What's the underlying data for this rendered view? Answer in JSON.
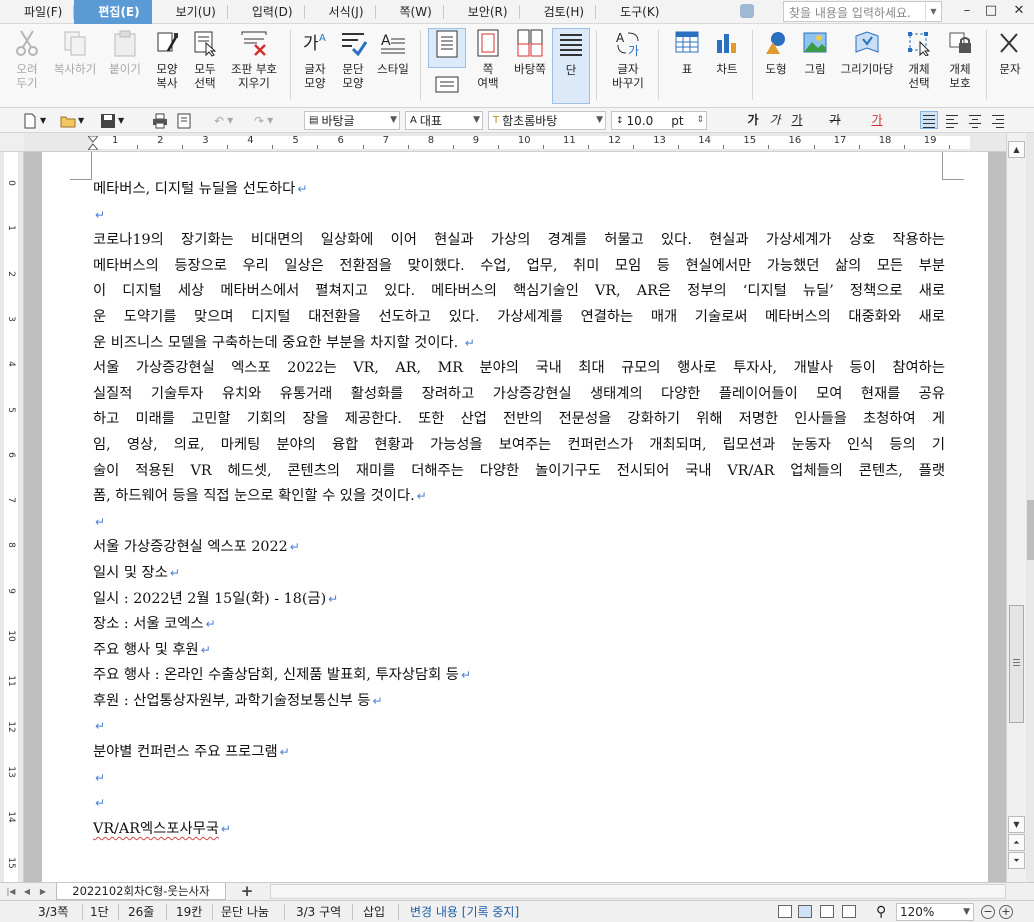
{
  "menu": {
    "items": [
      "파일(F)",
      "편집(E)",
      "보기(U)",
      "입력(D)",
      "서식(J)",
      "쪽(W)",
      "보안(R)",
      "검토(H)",
      "도구(K)"
    ],
    "active_index": 1,
    "search_placeholder": "찾을 내용을 입력하세요.",
    "minimize": "–",
    "restore": "□",
    "close": "✕"
  },
  "ribbon": {
    "cut": "오려\n두기",
    "copy": "복사하기",
    "paste": "붙이기",
    "format_copy": "모양\n복사",
    "select_all": "모두\n선택",
    "clear_format": "조판 부호\n지우기",
    "char_shape": "글자\n모양",
    "para_shape": "문단\n모양",
    "style": "스타일",
    "margin": "쪽\n여백",
    "page_size": "바탕쪽",
    "columns": "단",
    "char_replace": "글자\n바꾸기",
    "table": "표",
    "chart": "차트",
    "shape": "도형",
    "picture": "그림",
    "clipart": "그리기마당",
    "obj_select": "개체\n선택",
    "obj_protect": "개체\n보호",
    "text": "문자"
  },
  "toolbar": {
    "style_combo": "바탕글",
    "lang_combo": "대표",
    "font_combo": "함초롬바탕",
    "size_combo": "10.0",
    "size_unit": "pt",
    "bold": "가",
    "italic": "가",
    "underline": "가",
    "strike": "가",
    "color": "가"
  },
  "ruler": {
    "h_numbers": [
      "1",
      "2",
      "3",
      "4",
      "5",
      "6",
      "7",
      "8",
      "9",
      "10",
      "11",
      "12",
      "13",
      "14",
      "15",
      "16",
      "17",
      "18",
      "19"
    ],
    "v_numbers": [
      "0",
      "1",
      "2",
      "3",
      "4",
      "5",
      "6",
      "7",
      "8",
      "9",
      "10",
      "11",
      "12",
      "13",
      "14",
      "15"
    ]
  },
  "doc": {
    "title": "메타버스, 디지털 뉴딜을 선도하다",
    "p1_lines": [
      "코로나19의 장기화는 비대면의 일상화에 이어 현실과 가상의 경계를 허물고 있다. 현실과 가상세계가 상호 작용하는",
      "메타버스의 등장으로 우리 일상은 전환점을 맞이했다. 수업, 업무, 취미 모임 등 현실에서만 가능했던 삶의 모든 부분",
      "이 디지털 세상 메타버스에서 펼쳐지고 있다. 메타버스의 핵심기술인 VR, AR은 정부의 ‘디지털 뉴딜’ 정책으로 새로",
      "운 도약기를 맞으며 디지털 대전환을 선도하고 있다. 가상세계를 연결하는 매개 기술로써 메타버스의 대중화와 새로",
      "운 비즈니스 모델을 구축하는데 중요한 부분을 차지할 것이다. "
    ],
    "p2_lines": [
      "  서울 가상증강현실 엑스포 2022는 VR, AR, MR 분야의 국내 최대 규모의 행사로 투자사, 개발사 등이 참여하는",
      "실질적 기술투자 유치와 유통거래 활성화를 장려하고 가상증강현실 생태계의 다양한 플레이어들이 모여 현재를 공유",
      "하고 미래를 고민할 기회의 장을 제공한다. 또한 산업 전반의 전문성을 강화하기 위해 저명한 인사들을 초청하여 게",
      "임, 영상, 의료, 마케팅 분야의 융합 현황과 가능성을 보여주는 컨퍼런스가 개최되며, 립모션과 눈동자 인식 등의 기",
      "술이 적용된 VR 헤드셋, 콘텐츠의 재미를 더해주는 다양한 놀이기구도 전시되어 국내 VR/AR 업체들의 콘텐츠, 플랫",
      "폼, 하드웨어 등을 직접 눈으로 확인할 수 있을 것이다."
    ],
    "expo_title": "서울 가상증강현실 엑스포 2022",
    "date_place": "일시 및 장소",
    "date": "일시 : 2022년 2월 15일(화) - 18(금)",
    "place": "장소 : 서울 코엑스",
    "events_header": "주요 행사 및 후원",
    "events": "주요 행사 : 온라인 수출상담회, 신제품 발표회, 투자상담회 등",
    "sponsor": "후원 : 산업통상자원부, 과학기술정보통신부 등",
    "conf": "분야별 컨퍼런스 주요 프로그램",
    "office": "VR/AR엑스포사무국",
    "para_mark": "↵"
  },
  "tabs": {
    "doc_tab": "2022102회차C형-웃는사자",
    "add": "+"
  },
  "status": {
    "page": "3/3쪽",
    "col": "1단",
    "line": "26줄",
    "char": "19칸",
    "para_split": "문단 나눔",
    "section": "3/3 구역",
    "insert": "삽입",
    "track": "변경 내용 [기록 중지]",
    "zoom": "120%"
  }
}
